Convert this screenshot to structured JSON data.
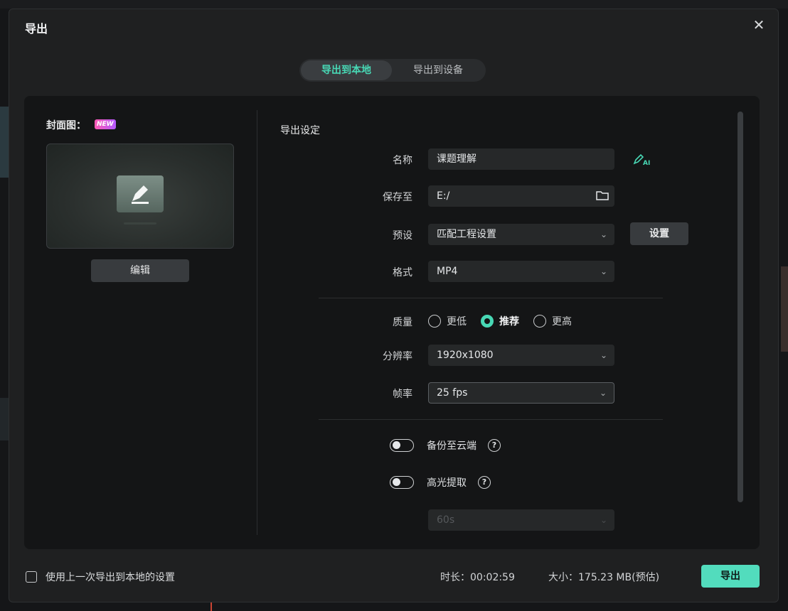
{
  "dialog": {
    "title": "导出",
    "close_icon": "close-icon"
  },
  "tabs": [
    {
      "label": "导出到本地",
      "active": true
    },
    {
      "label": "导出到设备",
      "active": false
    }
  ],
  "cover": {
    "label": "封面图：",
    "badge": "NEW",
    "edit_label": "编辑"
  },
  "settings": {
    "title": "导出设定",
    "name": {
      "label": "名称",
      "value": "课题理解"
    },
    "save_to": {
      "label": "保存至",
      "value": "E:/"
    },
    "preset": {
      "label": "预设",
      "value": "匹配工程设置",
      "button": "设置"
    },
    "format": {
      "label": "格式",
      "value": "MP4"
    },
    "quality": {
      "label": "质量",
      "options": [
        "更低",
        "推荐",
        "更高"
      ],
      "selected": "推荐"
    },
    "resolution": {
      "label": "分辨率",
      "value": "1920x1080"
    },
    "framerate": {
      "label": "帧率",
      "value": "25 fps"
    },
    "cloud_backup": {
      "label": "备份至云端",
      "on": false
    },
    "highlight": {
      "label": "高光提取",
      "on": false
    },
    "highlight_duration": {
      "value": "60s"
    }
  },
  "footer": {
    "reuse_label": "使用上一次导出到本地的设置",
    "duration": "时长：00:02:59",
    "size": "大小：175.23 MB(预估)",
    "export_label": "导出"
  },
  "colors": {
    "accent": "#48d8b5",
    "export_button": "#52dcbd",
    "panel": "#141516",
    "dialog": "#1f2021"
  }
}
